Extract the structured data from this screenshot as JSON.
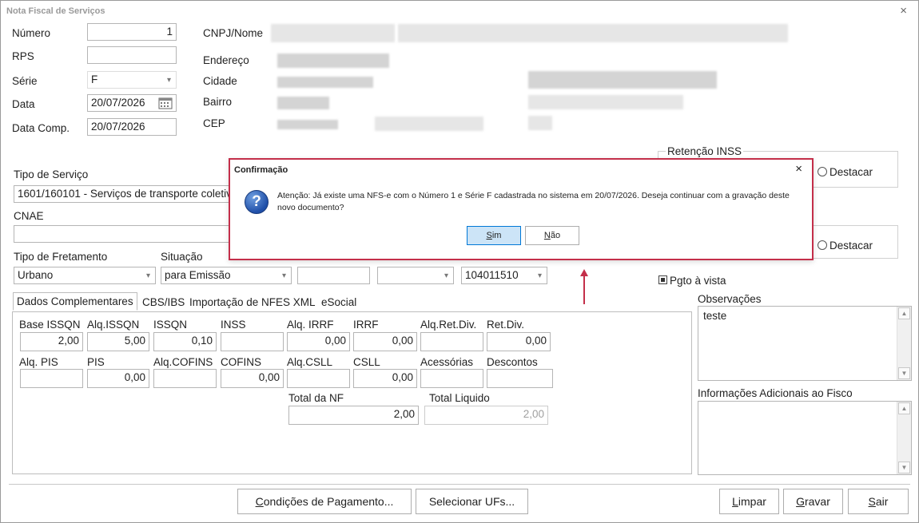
{
  "window": {
    "title": "Nota Fiscal de Serviços",
    "close": "×"
  },
  "left": {
    "numero_label": "Número",
    "numero_value": "1",
    "rps_label": "RPS",
    "rps_value": "",
    "serie_label": "Série",
    "serie_value": "F",
    "data_label": "Data",
    "data_value": "20/07/2026",
    "datacomp_label": "Data Comp.",
    "datacomp_value": "20/07/2026"
  },
  "client": {
    "cnpj_label": "CNPJ/Nome",
    "endereco_label": "Endereço",
    "cidade_label": "Cidade",
    "bairro_label": "Bairro",
    "cep_label": "CEP"
  },
  "servico": {
    "tipo_label": "Tipo de Serviço",
    "tipo_value": "1601/160101 - Serviços de transporte coletivo",
    "cnae_label": "CNAE",
    "cnae_value": ""
  },
  "fretamento": {
    "tipo_label": "Tipo de Fretamento",
    "tipo_value": "Urbano",
    "situacao_label": "Situação",
    "situacao_value": "para Emissão",
    "code_value": "104011510"
  },
  "retencao": {
    "inss_label": "Retenção INSS",
    "destacar_label": "Destacar",
    "destacar2_label": "Destacar",
    "pgto_label": "Pgto à vista"
  },
  "tabs": [
    "Dados Complementares",
    "CBS/IBS",
    "Importação de NFES XML",
    "eSocial"
  ],
  "fields": {
    "row1": [
      {
        "label": "Base ISSQN",
        "value": "2,00"
      },
      {
        "label": "Alq.ISSQN",
        "value": "5,00"
      },
      {
        "label": "ISSQN",
        "value": "0,10"
      },
      {
        "label": "INSS",
        "value": ""
      },
      {
        "label": "Alq. IRRF",
        "value": "0,00"
      },
      {
        "label": "IRRF",
        "value": "0,00"
      },
      {
        "label": "Alq.Ret.Div.",
        "value": ""
      },
      {
        "label": "Ret.Div.",
        "value": "0,00"
      }
    ],
    "row2": [
      {
        "label": "Alq. PIS",
        "value": ""
      },
      {
        "label": "PIS",
        "value": "0,00"
      },
      {
        "label": "Alq.COFINS",
        "value": ""
      },
      {
        "label": "COFINS",
        "value": "0,00"
      },
      {
        "label": "Alq.CSLL",
        "value": ""
      },
      {
        "label": "CSLL",
        "value": "0,00"
      },
      {
        "label": "Acessórias",
        "value": ""
      },
      {
        "label": "Descontos",
        "value": ""
      }
    ],
    "total_nf_label": "Total da NF",
    "total_nf_value": "2,00",
    "total_liq_label": "Total Liquido",
    "total_liq_value": "2,00"
  },
  "observacoes": {
    "label": "Observações",
    "value": "teste"
  },
  "info_adicionais": {
    "label": "Informações Adicionais ao Fisco",
    "value": ""
  },
  "buttons": {
    "condicoes_u": "C",
    "condicoes_rest": "ondições de Pagamento...",
    "selecionar": "Selecionar UFs...",
    "limpar_u": "L",
    "limpar_rest": "impar",
    "gravar_u": "G",
    "gravar_rest": "ravar",
    "sair_u": "S",
    "sair_rest": "air"
  },
  "dialog": {
    "title": "Confirmação",
    "close": "×",
    "icon": "?",
    "message": "Atenção: Já existe uma NFS-e com o Número 1 e Série F cadastrada no sistema em 20/07/2026. Deseja continuar com a gravação deste novo documento?",
    "sim_u": "S",
    "sim_rest": "im",
    "nao_u": "N",
    "nao_rest": "ão"
  },
  "colors": {
    "accent": "#c42f4a",
    "dialog_default_button": "#cce4f7"
  }
}
